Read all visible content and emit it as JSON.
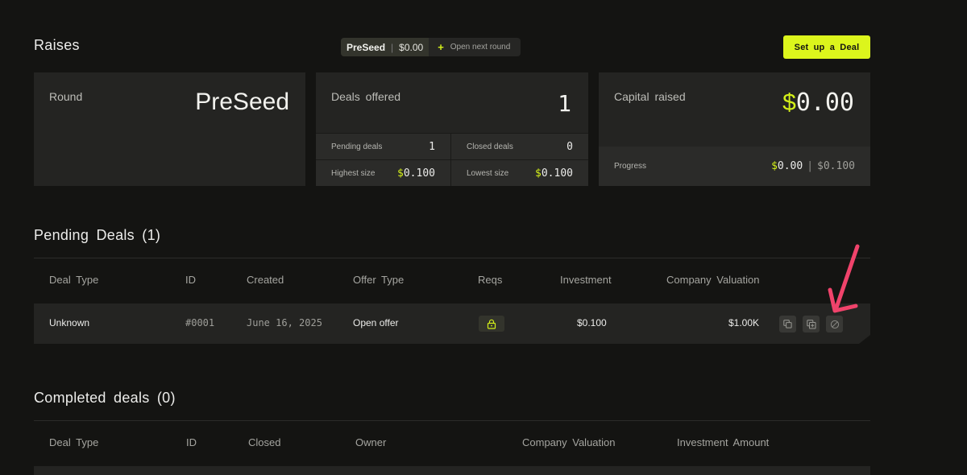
{
  "header": {
    "title": "Raises",
    "round_pill": {
      "name": "PreSeed",
      "amount": "$0.00",
      "next_label": "Open next round"
    },
    "setup_button": "Set up a Deal"
  },
  "cards": {
    "round": {
      "label": "Round",
      "value": "PreSeed"
    },
    "deals": {
      "label": "Deals offered",
      "value": "1",
      "pending_label": "Pending deals",
      "pending_value": "1",
      "closed_label": "Closed deals",
      "closed_value": "0",
      "highest_label": "Highest size",
      "highest_value": "0.100",
      "lowest_label": "Lowest size",
      "lowest_value": "0.100"
    },
    "capital": {
      "label": "Capital raised",
      "value": "0.00",
      "progress_label": "Progress",
      "progress_current": "0.00",
      "progress_max": "$0.100"
    }
  },
  "pending": {
    "title": "Pending Deals (1)",
    "columns": [
      "Deal Type",
      "ID",
      "Created",
      "Offer Type",
      "Reqs",
      "Investment",
      "Company Valuation"
    ],
    "rows": [
      {
        "deal_type": "Unknown",
        "id": "#0001",
        "created": "June 16, 2025",
        "offer_type": "Open offer",
        "investment": "$0.100",
        "valuation": "$1.00K"
      }
    ]
  },
  "completed": {
    "title": "Completed deals (0)",
    "columns": [
      "Deal Type",
      "ID",
      "Closed",
      "Owner",
      "Company Valuation",
      "Investment Amount"
    ]
  },
  "colors": {
    "accent": "#d4f019",
    "background": "#141412",
    "card": "#242422",
    "annotation_arrow": "#f0436b"
  },
  "icons": [
    "plus-icon",
    "lock-icon",
    "copy-icon",
    "duplicate-add-icon",
    "cancel-icon"
  ]
}
